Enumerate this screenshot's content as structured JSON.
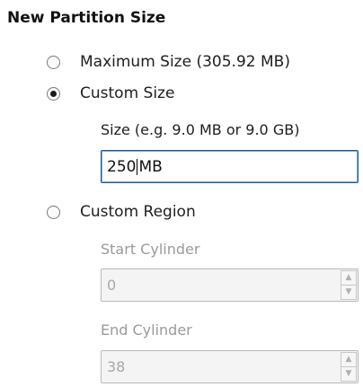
{
  "section": {
    "title": "New Partition Size"
  },
  "options": {
    "maximum": {
      "label": "Maximum Size (305.92 MB)",
      "selected": false
    },
    "custom_size": {
      "label": "Custom Size",
      "selected": true
    },
    "custom_region": {
      "label": "Custom Region",
      "selected": false
    }
  },
  "size_field": {
    "label": "Size (e.g. 9.0 MB or 9.0 GB)",
    "value_number": "250",
    "value_unit": "MB"
  },
  "start_cylinder": {
    "label": "Start Cylinder",
    "value": "0",
    "disabled": true
  },
  "end_cylinder": {
    "label": "End Cylinder",
    "value": "38",
    "disabled": true
  },
  "icons": {
    "spin_up": "chevron-up-icon",
    "spin_down": "chevron-down-icon"
  }
}
